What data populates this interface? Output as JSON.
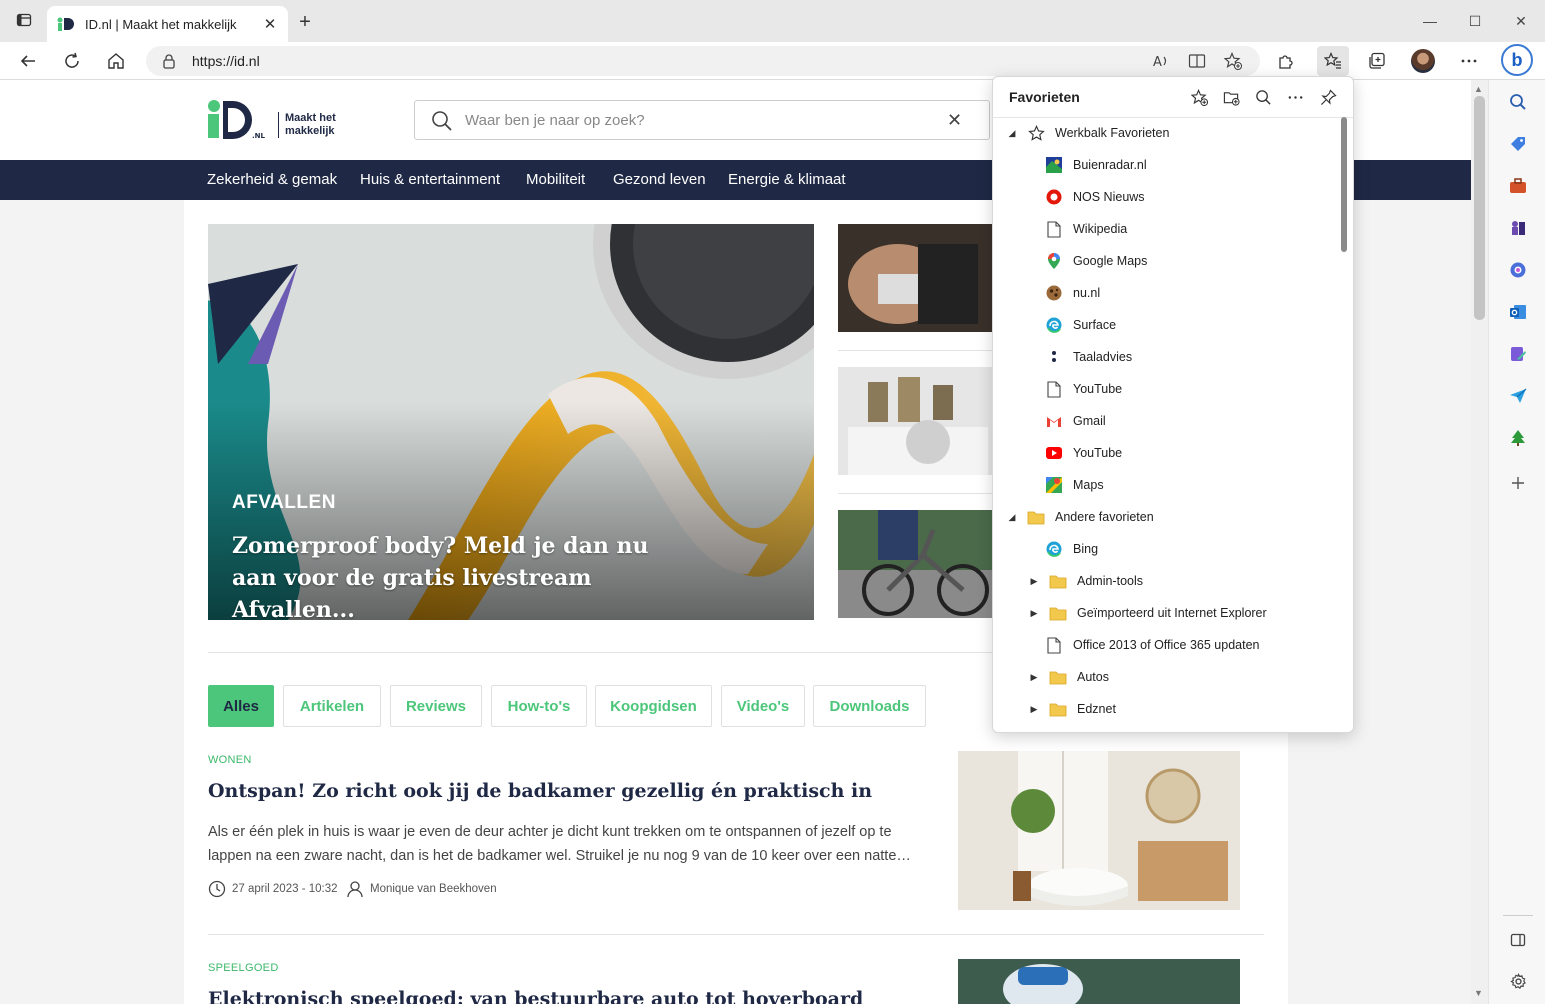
{
  "browser": {
    "tab_title": "ID.nl | Maakt het makkelijk",
    "url": "https://id.nl"
  },
  "site": {
    "logo_tagline_1": "Maakt het",
    "logo_tagline_2": "makkelijk",
    "search_placeholder": "Waar ben je naar op zoek?",
    "nav": [
      "Zekerheid & gemak",
      "Huis & entertainment",
      "Mobiliteit",
      "Gezond leven",
      "Energie & klimaat"
    ],
    "hero": {
      "category": "AFVALLEN",
      "title": "Zomerproof body? Meld je dan nu aan voor de gratis livestream Afvallen..."
    },
    "filters": [
      "Alles",
      "Artikelen",
      "Reviews",
      "How-to's",
      "Koopgidsen",
      "Video's",
      "Downloads"
    ],
    "articles": [
      {
        "category": "WONEN",
        "title": "Ontspan! Zo richt ook jij de badkamer gezellig én praktisch in",
        "body": "Als er één plek in huis is waar je even de deur achter je dicht kunt trekken om te ontspannen of jezelf op te lappen na een zware nacht, dan is het de badkamer wel. Struikel je nu nog 9 van de 10 keer over een natte…",
        "date": "27 april 2023 - 10:32",
        "author": "Monique van Beekhoven"
      },
      {
        "category": "SPEELGOED",
        "title": "Elektronisch speelgoed: van bestuurbare auto tot hoverboard"
      }
    ]
  },
  "favorites": {
    "title": "Favorieten",
    "toolbar_folder": "Werkbalk Favorieten",
    "toolbar_items": [
      {
        "label": "Buienradar.nl",
        "icon": "buienradar-icon"
      },
      {
        "label": "NOS Nieuws",
        "icon": "nos-icon"
      },
      {
        "label": "Wikipedia",
        "icon": "page-icon"
      },
      {
        "label": "Google Maps",
        "icon": "google-maps-icon"
      },
      {
        "label": "nu.nl",
        "icon": "nunl-icon"
      },
      {
        "label": "Surface",
        "icon": "edge-icon"
      },
      {
        "label": "Taaladvies",
        "icon": "taaladvies-icon"
      },
      {
        "label": "YouTube",
        "icon": "page-icon"
      },
      {
        "label": "Gmail",
        "icon": "gmail-icon"
      },
      {
        "label": "YouTube",
        "icon": "youtube-icon"
      },
      {
        "label": "Maps",
        "icon": "maps-icon"
      }
    ],
    "other_folder": "Andere favorieten",
    "other_items": [
      {
        "label": "Bing",
        "icon": "edge-icon",
        "folder": false
      },
      {
        "label": "Admin-tools",
        "icon": "folder-icon",
        "folder": true
      },
      {
        "label": "Geïmporteerd uit Internet Explorer",
        "icon": "folder-icon",
        "folder": true
      },
      {
        "label": "Office 2013 of Office 365 updaten",
        "icon": "page-icon",
        "folder": false
      },
      {
        "label": "Autos",
        "icon": "folder-icon",
        "folder": true
      },
      {
        "label": "Edznet",
        "icon": "folder-icon",
        "folder": true
      }
    ]
  },
  "colors": {
    "brand_navy": "#1f2845",
    "brand_green": "#4cc67a",
    "folder_yellow": "#f2c94c"
  }
}
